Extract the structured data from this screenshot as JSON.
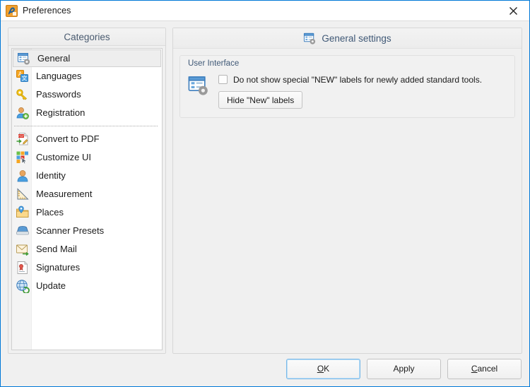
{
  "window": {
    "title": "Preferences",
    "icon": "app-icon",
    "close_label": "✕",
    "accent_color": "#0078d7"
  },
  "sidebar": {
    "header": "Categories",
    "groups": [
      {
        "items": [
          {
            "label": "General",
            "icon": "general-settings-icon",
            "selected": true
          },
          {
            "label": "Languages",
            "icon": "languages-icon",
            "selected": false
          },
          {
            "label": "Passwords",
            "icon": "key-icon",
            "selected": false
          },
          {
            "label": "Registration",
            "icon": "user-add-icon",
            "selected": false
          }
        ]
      },
      {
        "items": [
          {
            "label": "Convert to PDF",
            "icon": "convert-pdf-icon",
            "selected": false
          },
          {
            "label": "Customize UI",
            "icon": "customize-ui-icon",
            "selected": false
          },
          {
            "label": "Identity",
            "icon": "identity-icon",
            "selected": false
          },
          {
            "label": "Measurement",
            "icon": "ruler-icon",
            "selected": false
          },
          {
            "label": "Places",
            "icon": "places-folder-icon",
            "selected": false
          },
          {
            "label": "Scanner Presets",
            "icon": "scanner-icon",
            "selected": false
          },
          {
            "label": "Send Mail",
            "icon": "send-mail-icon",
            "selected": false
          },
          {
            "label": "Signatures",
            "icon": "signature-icon",
            "selected": false
          },
          {
            "label": "Update",
            "icon": "update-globe-icon",
            "selected": false
          }
        ]
      }
    ]
  },
  "panel": {
    "title": "General settings",
    "icon": "general-settings-icon",
    "group": {
      "title": "User Interface",
      "icon": "general-settings-icon",
      "checkbox": {
        "label": "Do not show special \"NEW\" labels for newly added standard tools.",
        "checked": false
      },
      "button": {
        "label": "Hide \"New\" labels"
      }
    }
  },
  "footer": {
    "buttons": [
      {
        "label": "OK",
        "accel": "O",
        "accel_index": 0,
        "default": true
      },
      {
        "label": "Apply",
        "accel": "",
        "accel_index": -1,
        "default": false
      },
      {
        "label": "Cancel",
        "accel": "C",
        "accel_index": 0,
        "default": false
      }
    ]
  }
}
